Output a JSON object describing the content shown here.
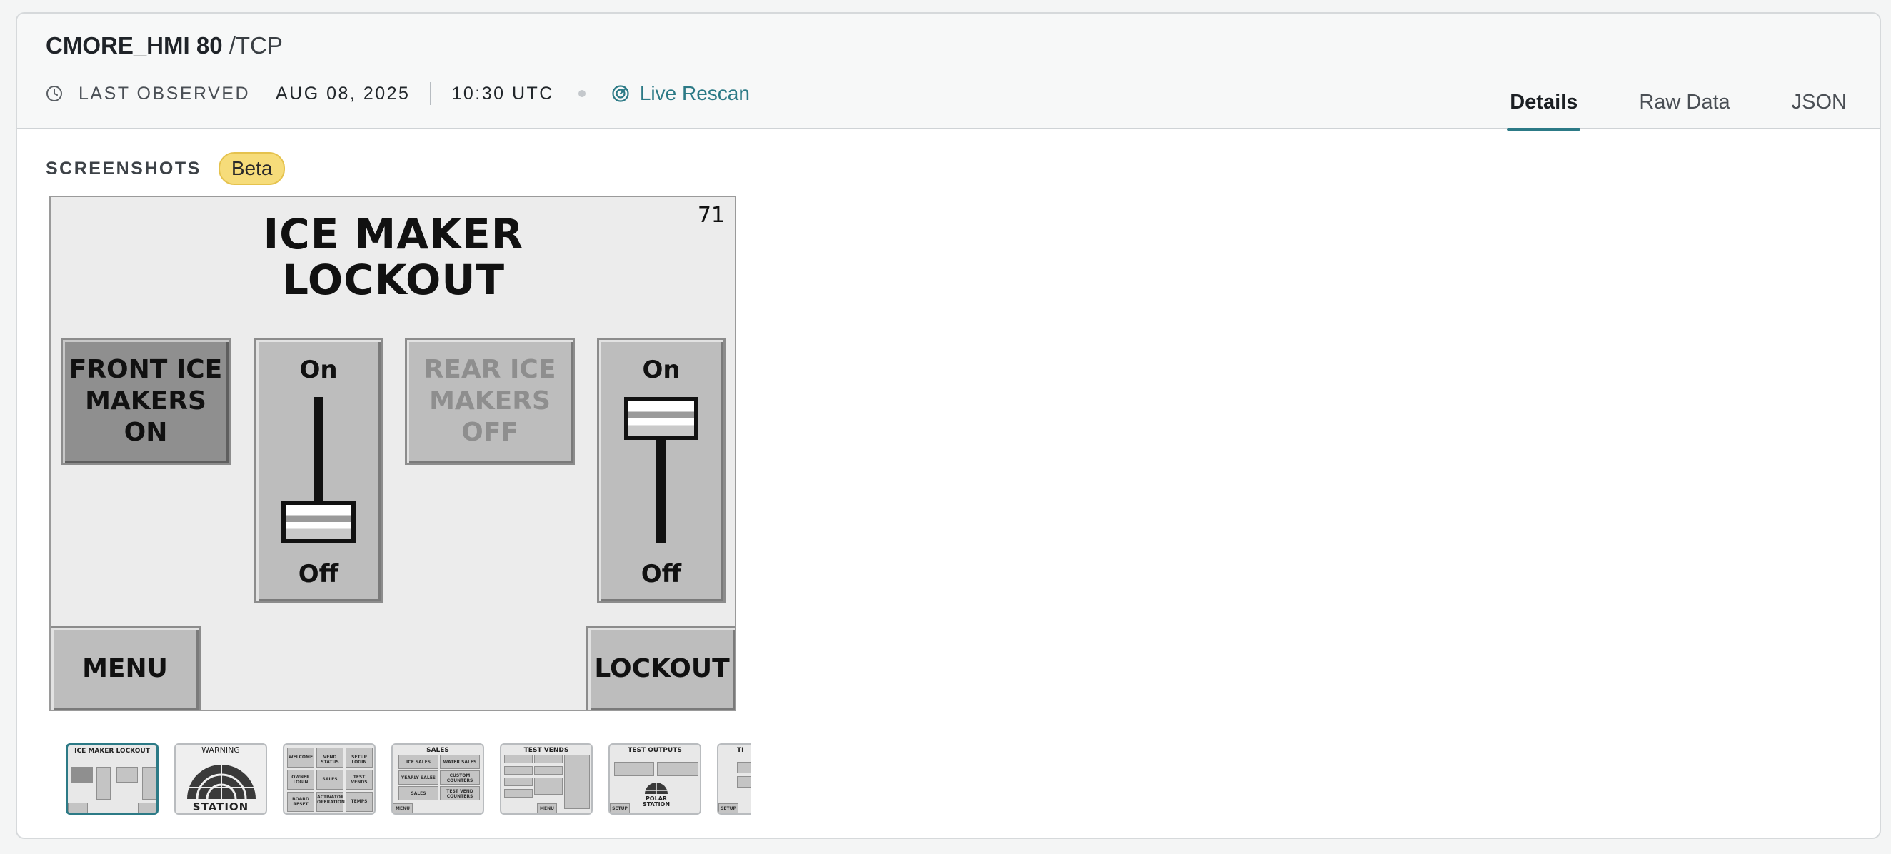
{
  "header": {
    "host": "CMORE_HMI 80",
    "port": "/TCP",
    "meta": {
      "label": "LAST OBSERVED",
      "date": "AUG 08, 2025",
      "time": "10:30 UTC",
      "rescan_label": "Live Rescan"
    },
    "tabs": [
      {
        "label": "Details",
        "active": true
      },
      {
        "label": "Raw Data",
        "active": false
      },
      {
        "label": "JSON",
        "active": false
      }
    ]
  },
  "screenshots": {
    "label": "SCREENSHOTS",
    "badge": "Beta",
    "main": {
      "number": "71",
      "title_line1": "ICE MAKER",
      "title_line2": "LOCKOUT",
      "front_button": [
        "FRONT ICE",
        "MAKERS",
        "ON"
      ],
      "rear_button": [
        "REAR ICE",
        "MAKERS",
        "OFF"
      ],
      "switch_on": "On",
      "switch_off": "Off",
      "menu_button": "MENU",
      "lockout_button": "LOCKOUT"
    },
    "thumbnails": [
      {
        "title": "ICE MAKER LOCKOUT",
        "selected": true
      },
      {
        "title": "WARNING",
        "selected": false,
        "caption": "STATION"
      },
      {
        "title": "",
        "selected": false,
        "cells": [
          "WELCOME",
          "VEND STATUS",
          "SETUP LOGIN",
          "OWNER LOGIN",
          "SALES",
          "TEST VENDS",
          "BOARD RESET",
          "ACTIVATOR OPERATION",
          "TEMPS"
        ]
      },
      {
        "title": "SALES",
        "selected": false,
        "cells": [
          "ICE SALES",
          "WATER SALES",
          "YEARLY SALES",
          "CUSTOM COUNTERS",
          "SALES",
          "TEST VEND COUNTERS"
        ],
        "menu": "MENU"
      },
      {
        "title": "TEST VENDS",
        "selected": false,
        "menu": "MENU"
      },
      {
        "title": "TEST OUTPUTS",
        "selected": false,
        "caption": "POLAR STATION",
        "setup": "SETUP"
      },
      {
        "title": "TI",
        "selected": false,
        "setup": "SETUP"
      }
    ]
  },
  "colors": {
    "accent": "#2c7a86",
    "badge": "#f6dc7a",
    "hmi_background": "#ececec",
    "hmi_button": "#bdbdbd"
  }
}
